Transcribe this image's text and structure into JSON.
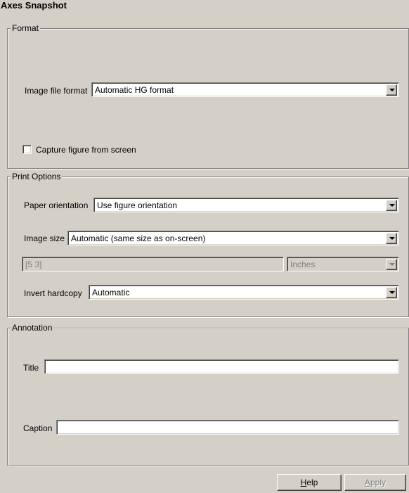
{
  "window_title": "Axes Snapshot",
  "format": {
    "legend": "Format",
    "image_file_format_label": "Image file format",
    "image_file_format_value": "Automatic HG format",
    "capture_checkbox_label": "Capture figure from screen",
    "capture_checked": false
  },
  "print_options": {
    "legend": "Print Options",
    "paper_orientation_label": "Paper orientation",
    "paper_orientation_value": "Use figure orientation",
    "image_size_label": "Image size",
    "image_size_value": "Automatic (same size as on-screen)",
    "size_value": "[5 3]",
    "units_value": "Inches",
    "invert_hardcopy_label": "Invert hardcopy",
    "invert_hardcopy_value": "Automatic"
  },
  "annotation": {
    "legend": "Annotation",
    "title_label": "Title",
    "title_value": "",
    "caption_label": "Caption",
    "caption_value": ""
  },
  "buttons": {
    "help_first": "H",
    "help_rest": "elp",
    "apply_first": "A",
    "apply_rest": "pply"
  }
}
